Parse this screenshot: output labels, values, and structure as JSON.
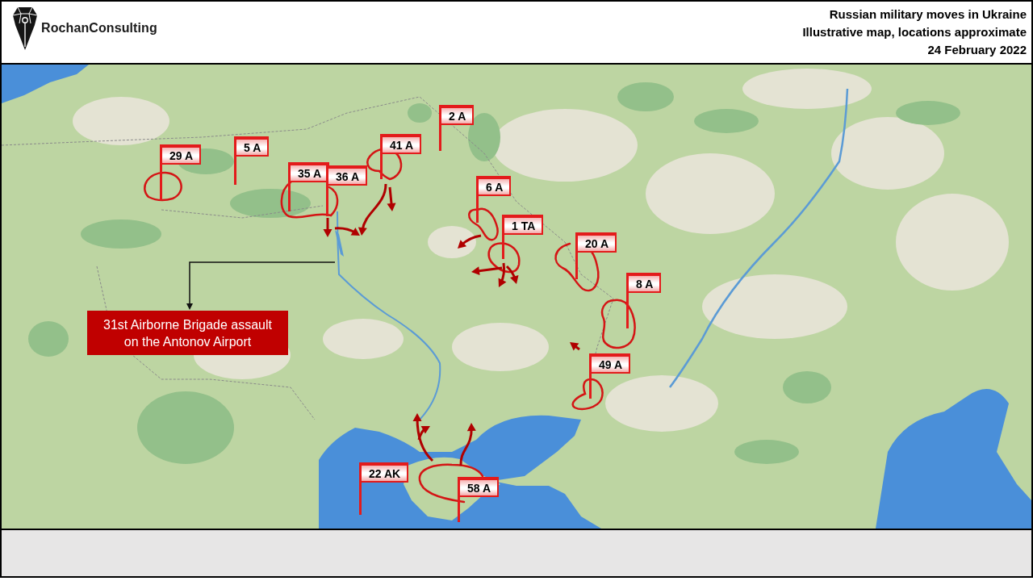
{
  "header": {
    "logo_text": "RochanConsulting",
    "title_lines": [
      "Russian military moves in Ukraine",
      "Illustrative map, locations approximate",
      "24 February 2022"
    ]
  },
  "map": {
    "formations": [
      {
        "label": "29 A"
      },
      {
        "label": "5 A"
      },
      {
        "label": "35 A"
      },
      {
        "label": "36 A"
      },
      {
        "label": "41 A"
      },
      {
        "label": "2 A"
      },
      {
        "label": "6 A"
      },
      {
        "label": "1 TA"
      },
      {
        "label": "20 A"
      },
      {
        "label": "8 A"
      },
      {
        "label": "49 A"
      },
      {
        "label": "22 AK"
      },
      {
        "label": "58 A"
      }
    ],
    "callout": {
      "text": "31st Airborne Brigade assault on the Antonov Airport"
    }
  }
}
